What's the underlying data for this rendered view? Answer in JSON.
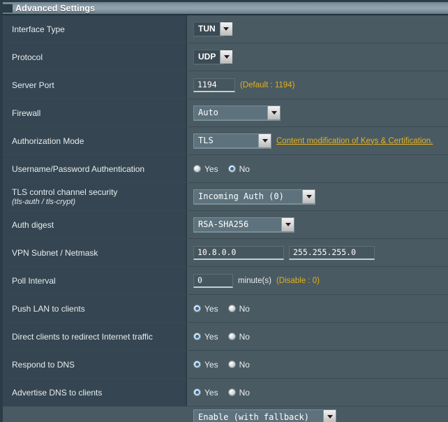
{
  "panel": {
    "title": "Advanced Settings",
    "accent_link_color": "#e3b320",
    "hint_color": "#e0b11f",
    "radio_selected_color": "#1d6fad",
    "label_bg": "#354551",
    "value_bg": "#4a5a62"
  },
  "yes_label": "Yes",
  "no_label": "No",
  "rows": {
    "interface_type": {
      "label": "Interface Type",
      "value": "TUN"
    },
    "protocol": {
      "label": "Protocol",
      "value": "UDP"
    },
    "server_port": {
      "label": "Server Port",
      "value": "1194",
      "hint": "(Default : 1194)"
    },
    "firewall": {
      "label": "Firewall",
      "value": "Auto"
    },
    "authorization_mode": {
      "label": "Authorization Mode",
      "value": "TLS",
      "link": "Content modification of Keys & Certification."
    },
    "username_password_auth": {
      "label": "Username/Password Authentication",
      "yes_selected": false,
      "no_selected": true
    },
    "tls_control_channel": {
      "label": "TLS control channel security",
      "sublabel": "(tls-auth / tls-crypt)",
      "value": "Incoming Auth (0)"
    },
    "auth_digest": {
      "label": "Auth digest",
      "value": "RSA-SHA256"
    },
    "vpn_subnet_netmask": {
      "label": "VPN Subnet / Netmask",
      "subnet": "10.8.0.0",
      "netmask": "255.255.255.0"
    },
    "poll_interval": {
      "label": "Poll Interval",
      "value": "0",
      "unit": "minute(s)",
      "hint": "(Disable : 0)"
    },
    "push_lan_to_clients": {
      "label": "Push LAN to clients",
      "yes_selected": true,
      "no_selected": false
    },
    "direct_clients_redirect": {
      "label": "Direct clients to redirect Internet traffic",
      "yes_selected": true,
      "no_selected": false
    },
    "respond_to_dns": {
      "label": "Respond to DNS",
      "yes_selected": true,
      "no_selected": false
    },
    "advertise_dns_to_clients": {
      "label": "Advertise DNS to clients",
      "yes_selected": true,
      "no_selected": false
    },
    "partial_bottom": {
      "label": "",
      "value": "Enable (with fallback)"
    }
  }
}
